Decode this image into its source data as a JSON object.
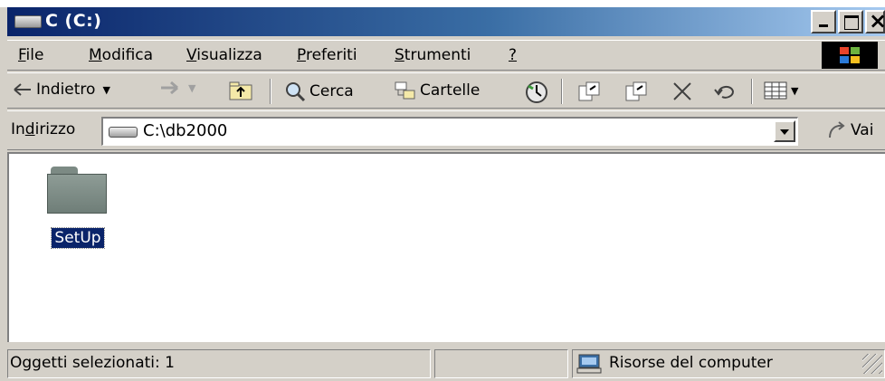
{
  "window": {
    "title": "C (C:)",
    "accent_color": "#0a246a"
  },
  "menu": [
    {
      "label": "File",
      "access": "F",
      "rest": "ile"
    },
    {
      "label": "Modifica",
      "access": "M",
      "rest": "odifica"
    },
    {
      "label": "Visualizza",
      "access": "V",
      "rest": "isualizza"
    },
    {
      "label": "Preferiti",
      "access": "P",
      "rest": "referiti"
    },
    {
      "label": "Strumenti",
      "access": "S",
      "rest": "trumenti"
    },
    {
      "label": "?",
      "access": "?",
      "rest": ""
    }
  ],
  "toolbar": {
    "back_label": "Indietro",
    "search_label": "Cerca",
    "folders_label": "Cartelle",
    "icons": [
      "back-arrow-icon",
      "forward-arrow-icon",
      "up-folder-icon",
      "search-icon",
      "folders-icon",
      "history-icon",
      "move-to-icon",
      "copy-to-icon",
      "delete-icon",
      "undo-icon",
      "views-icon"
    ]
  },
  "address": {
    "label_pre": "In",
    "label_access": "d",
    "label_post": "irizzo",
    "value": "C:\\db2000",
    "go_label": "Vai"
  },
  "content": {
    "items": [
      {
        "name": "SetUp",
        "type": "folder",
        "selected": true
      }
    ]
  },
  "status": {
    "selection_text": "Oggetti selezionati: 1",
    "location_text": "Risorse del computer"
  }
}
